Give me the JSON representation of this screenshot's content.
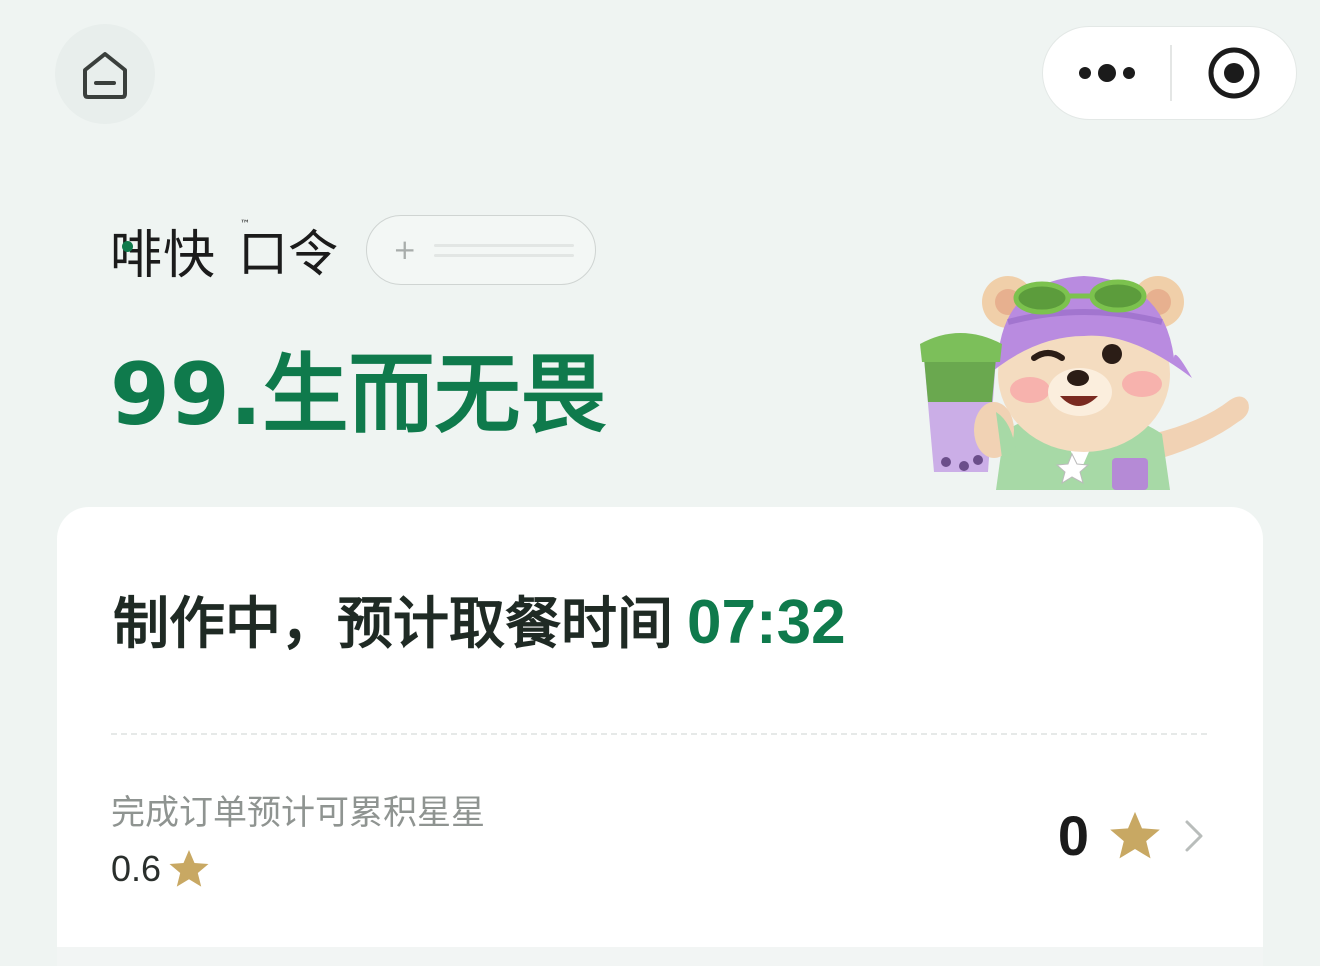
{
  "topbar": {
    "home_icon": "home-icon",
    "more_icon": "more-dots-icon",
    "target_icon": "target-circle-icon"
  },
  "brand": {
    "name": "啡快",
    "trademark": "™",
    "code_label": "口令",
    "add_button_symbol": "+"
  },
  "pickup": {
    "code_title": "99.生而无畏"
  },
  "status": {
    "text": "制作中，预计取餐时间",
    "time": "07:32"
  },
  "stars": {
    "earn_label": "完成订单预计可累积星星",
    "earn_value": "0.6",
    "total": "0",
    "star_color": "#c8a863"
  },
  "colors": {
    "accent": "#0f7a4c",
    "background": "#eff4f2"
  }
}
